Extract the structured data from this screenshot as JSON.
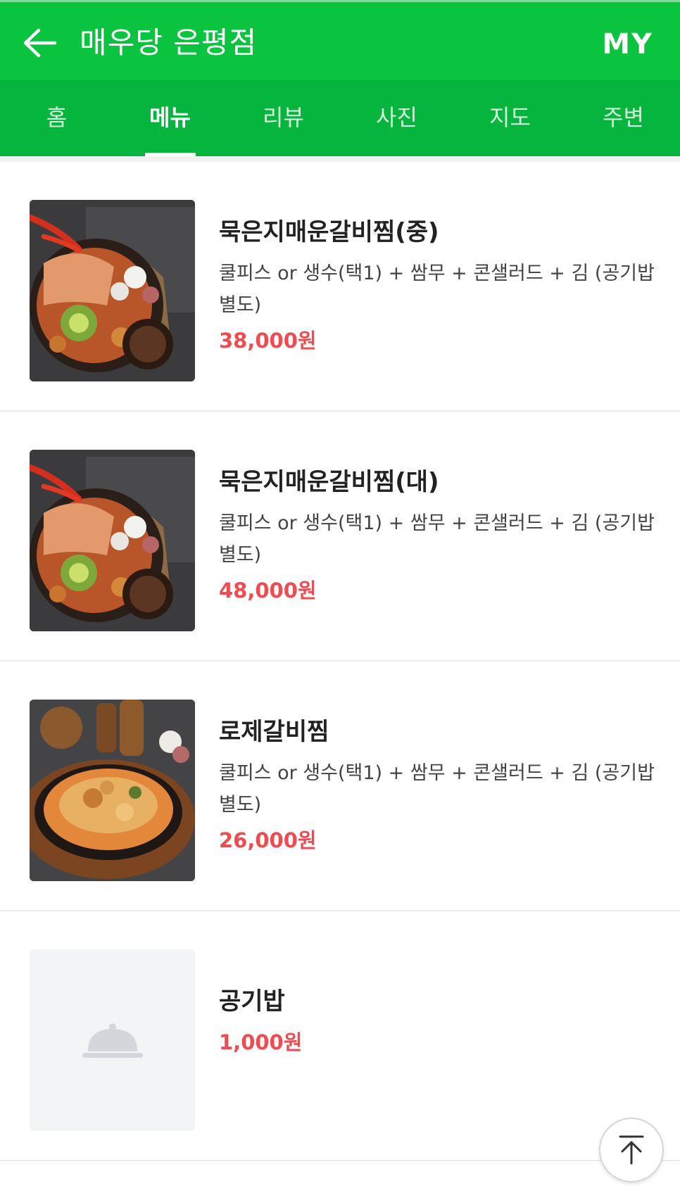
{
  "header": {
    "title": "매우당 은평점",
    "my_label": "MY",
    "back_icon": "arrow-left-icon"
  },
  "tabs": [
    {
      "label": "홈",
      "active": false
    },
    {
      "label": "메뉴",
      "active": true
    },
    {
      "label": "리뷰",
      "active": false
    },
    {
      "label": "사진",
      "active": false
    },
    {
      "label": "지도",
      "active": false
    },
    {
      "label": "주변",
      "active": false
    }
  ],
  "menu": {
    "items": [
      {
        "name": "묵은지매운갈비찜(중)",
        "description": "쿨피스 or 생수(택1) + 쌈무 + 콘샐러드 + 김 (공기밥 별도)",
        "price": "38,000원"
      },
      {
        "name": "묵은지매운갈비찜(대)",
        "description": "쿨피스 or 생수(택1) + 쌈무 + 콘샐러드 + 김 (공기밥 별도)",
        "price": "48,000원"
      },
      {
        "name": "로제갈비찜",
        "description": "쿨피스 or 생수(택1) + 쌈무 + 콘샐러드 + 김 (공기밥 별도)",
        "price": "26,000원"
      },
      {
        "name": "공기밥",
        "price": "1,000원"
      }
    ]
  },
  "scroll_top_icon": "arrow-up-to-top-icon",
  "colors": {
    "header_green": "#0ac33f",
    "tab_green": "#06b53d",
    "price_red": "#ef4c51"
  }
}
